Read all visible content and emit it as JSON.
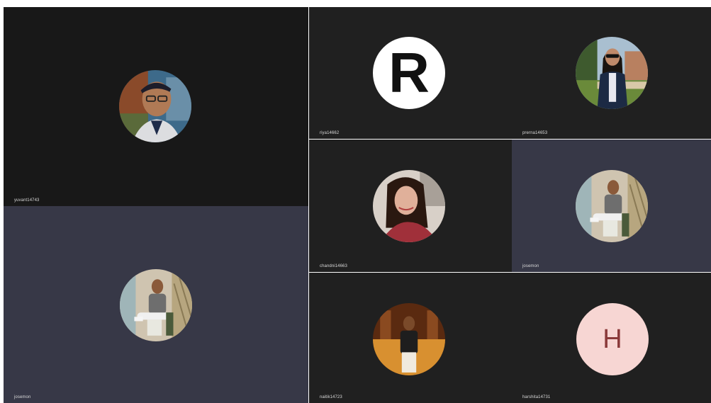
{
  "participants": [
    {
      "name": "yuvant14743",
      "avatar": "photo-young-man-glasses-cap"
    },
    {
      "name": "riya14662",
      "avatar": "letter-avatar",
      "initial": "R"
    },
    {
      "name": "prerna14653",
      "avatar": "photo-woman-sunglasses-outdoor"
    },
    {
      "name": "chandni14663",
      "avatar": "photo-woman-selfie"
    },
    {
      "name": "josemon",
      "avatar": "photo-man-sitting-chair"
    },
    {
      "name": "josemon",
      "avatar": "photo-man-sitting-chair"
    },
    {
      "name": "naitik14723",
      "avatar": "photo-man-standing-night"
    },
    {
      "name": "harshita14731",
      "avatar": "letter-avatar",
      "initial": "H"
    }
  ],
  "colors": {
    "tile_dark": "#181818",
    "tile_mid": "#202020",
    "tile_speaking": "#373847",
    "riya_avatar_bg": "#ffffff",
    "riya_initial": "#111111",
    "harshita_avatar_bg": "#f7d6d3",
    "harshita_initial": "#8a3a3a"
  }
}
